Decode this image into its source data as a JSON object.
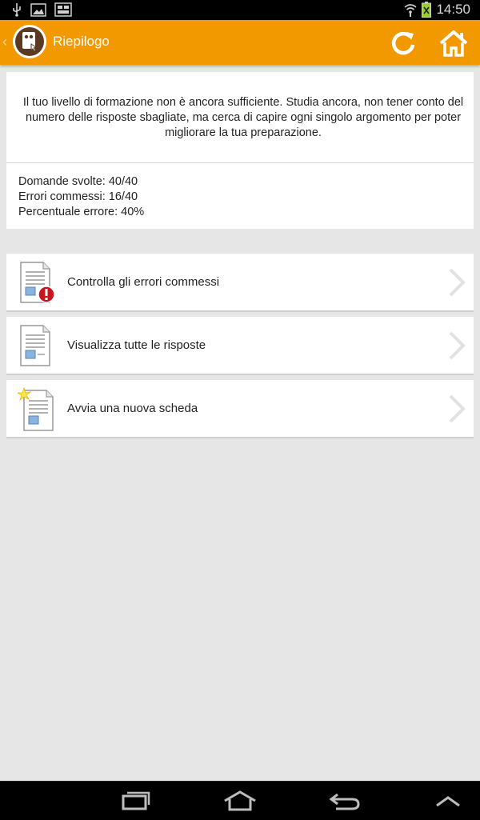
{
  "status_bar": {
    "time": "14:50",
    "icons": [
      "usb-icon",
      "image-icon",
      "gallery-icon",
      "wifi-icon",
      "battery-icon"
    ]
  },
  "action_bar": {
    "title": "Riepilogo",
    "accent_color": "#f29900",
    "buttons": [
      "refresh-icon",
      "home-icon"
    ]
  },
  "summary": {
    "message": "Il tuo livello di formazione non è ancora sufficiente. Studia ancora, non tener conto del numero delle risposte sbagliate, ma cerca di capire ogni singolo argomento per poter migliorare la tua preparazione."
  },
  "stats": {
    "questions": "Domande svolte: 40/40",
    "errors": "Errori commessi: 16/40",
    "error_rate": "Percentuale errore: 40%"
  },
  "menu": {
    "items": [
      {
        "label": "Controlla gli errori commessi",
        "icon": "document-error-icon"
      },
      {
        "label": "Visualizza tutte le risposte",
        "icon": "document-icon"
      },
      {
        "label": "Avvia una nuova scheda",
        "icon": "document-new-icon"
      }
    ]
  },
  "nav_bar": {
    "buttons": [
      "recent-apps-icon",
      "home-icon",
      "back-icon",
      "expand-icon"
    ]
  }
}
